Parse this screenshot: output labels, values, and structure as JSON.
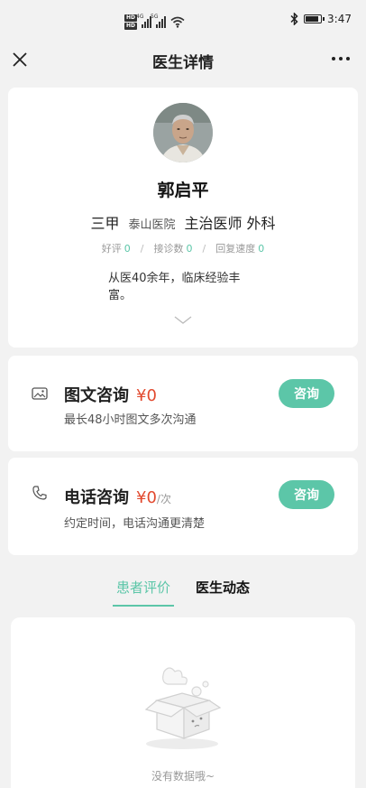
{
  "status_bar": {
    "network_badge_1": "HD",
    "network_badge_2": "HD",
    "signal_1_label": "4G",
    "signal_2_label": "5G",
    "time": "3:47"
  },
  "nav": {
    "title": "医生详情"
  },
  "doctor": {
    "name": "郭启平",
    "level": "三甲",
    "hospital": "泰山医院",
    "title_dept": "主治医师 外科",
    "stats": [
      {
        "label": "好评",
        "value": "0"
      },
      {
        "label": "接诊数",
        "value": "0"
      },
      {
        "label": "回复速度",
        "value": "0"
      }
    ],
    "intro": "从医40余年，临床经验丰富。"
  },
  "consultations": [
    {
      "title": "图文咨询",
      "price": "¥0",
      "unit": "",
      "desc": "最长48小时图文多次沟通",
      "button": "咨询",
      "icon": "image-icon"
    },
    {
      "title": "电话咨询",
      "price": "¥0",
      "unit": "/次",
      "desc": "约定时间，电话沟通更清楚",
      "button": "咨询",
      "icon": "phone-icon"
    }
  ],
  "tabs": [
    {
      "label": "患者评价",
      "active": true
    },
    {
      "label": "医生动态",
      "active": false
    }
  ],
  "reviews": {
    "empty_text": "没有数据哦~"
  },
  "colors": {
    "accent": "#5cc6a8",
    "price": "#e24a2f",
    "background": "#f2f2f2"
  }
}
